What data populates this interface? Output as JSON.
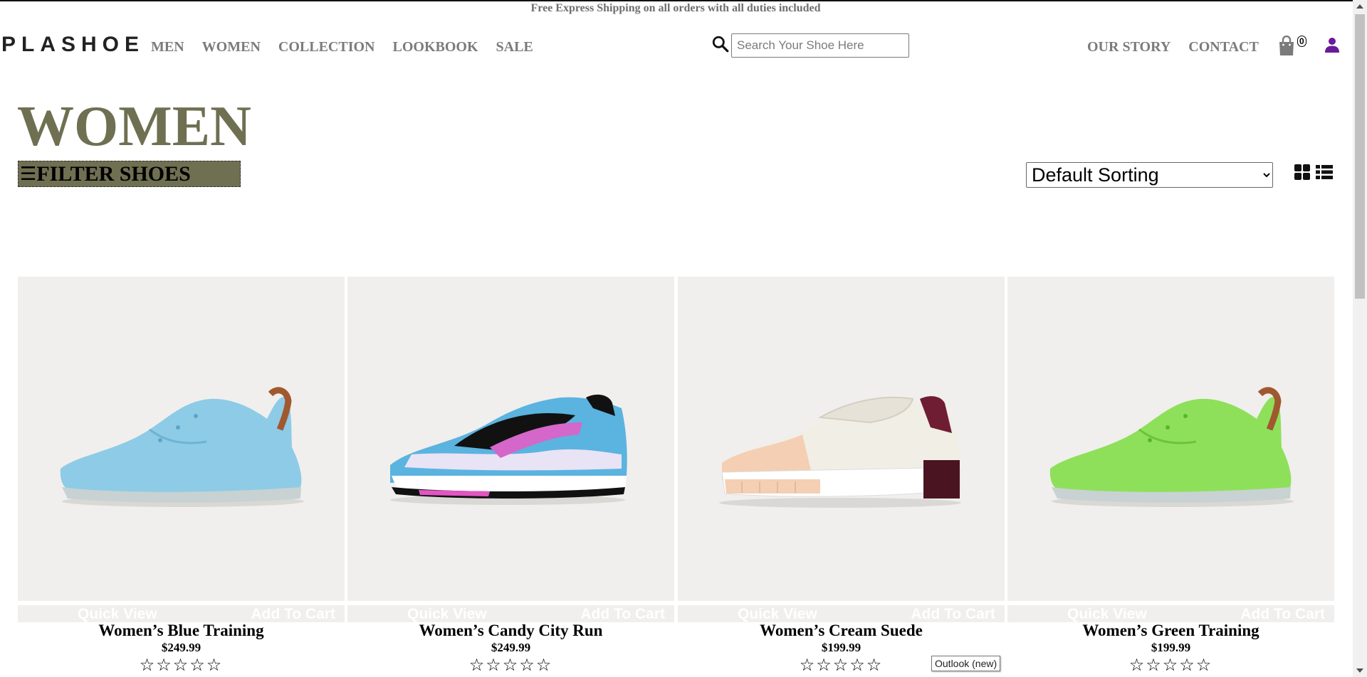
{
  "announcement": "Free Express Shipping on all orders with all duties included",
  "header": {
    "logo": "PLASHOE",
    "nav": [
      {
        "label": "MEN"
      },
      {
        "label": "WOMEN"
      },
      {
        "label": "COLLECTION"
      },
      {
        "label": "LOOKBOOK"
      },
      {
        "label": "SALE"
      }
    ],
    "search": {
      "placeholder": "Search Your Shoe Here",
      "value": ""
    },
    "right_nav": [
      {
        "label": "OUR STORY"
      },
      {
        "label": "CONTACT"
      }
    ],
    "cart_count": "0"
  },
  "page": {
    "title": "WOMEN",
    "filter_label": "FILTER SHOES",
    "sort_selected": "Default Sorting"
  },
  "product_actions": {
    "quick_view": "Quick View",
    "add_to_cart": "Add To Cart"
  },
  "products": [
    {
      "name": "Women’s Blue Training",
      "price": "$249.99",
      "stars": "☆☆☆☆☆",
      "color": "#8ecbe6"
    },
    {
      "name": "Women’s Candy City Run",
      "price": "$249.99",
      "stars": "☆☆☆☆☆",
      "color": "#5bb3df"
    },
    {
      "name": "Women’s Cream Suede",
      "price": "$199.99",
      "stars": "☆☆☆☆☆",
      "color": "#f0ece4"
    },
    {
      "name": "Women’s Green Training",
      "price": "$199.99",
      "stars": "☆☆☆☆☆",
      "color": "#8ee05a"
    }
  ],
  "tooltip": "Outlook (new)",
  "colors": {
    "accent": "#6f7052",
    "nav_text": "#7b7b7b",
    "user_icon": "#6a1b9a"
  }
}
